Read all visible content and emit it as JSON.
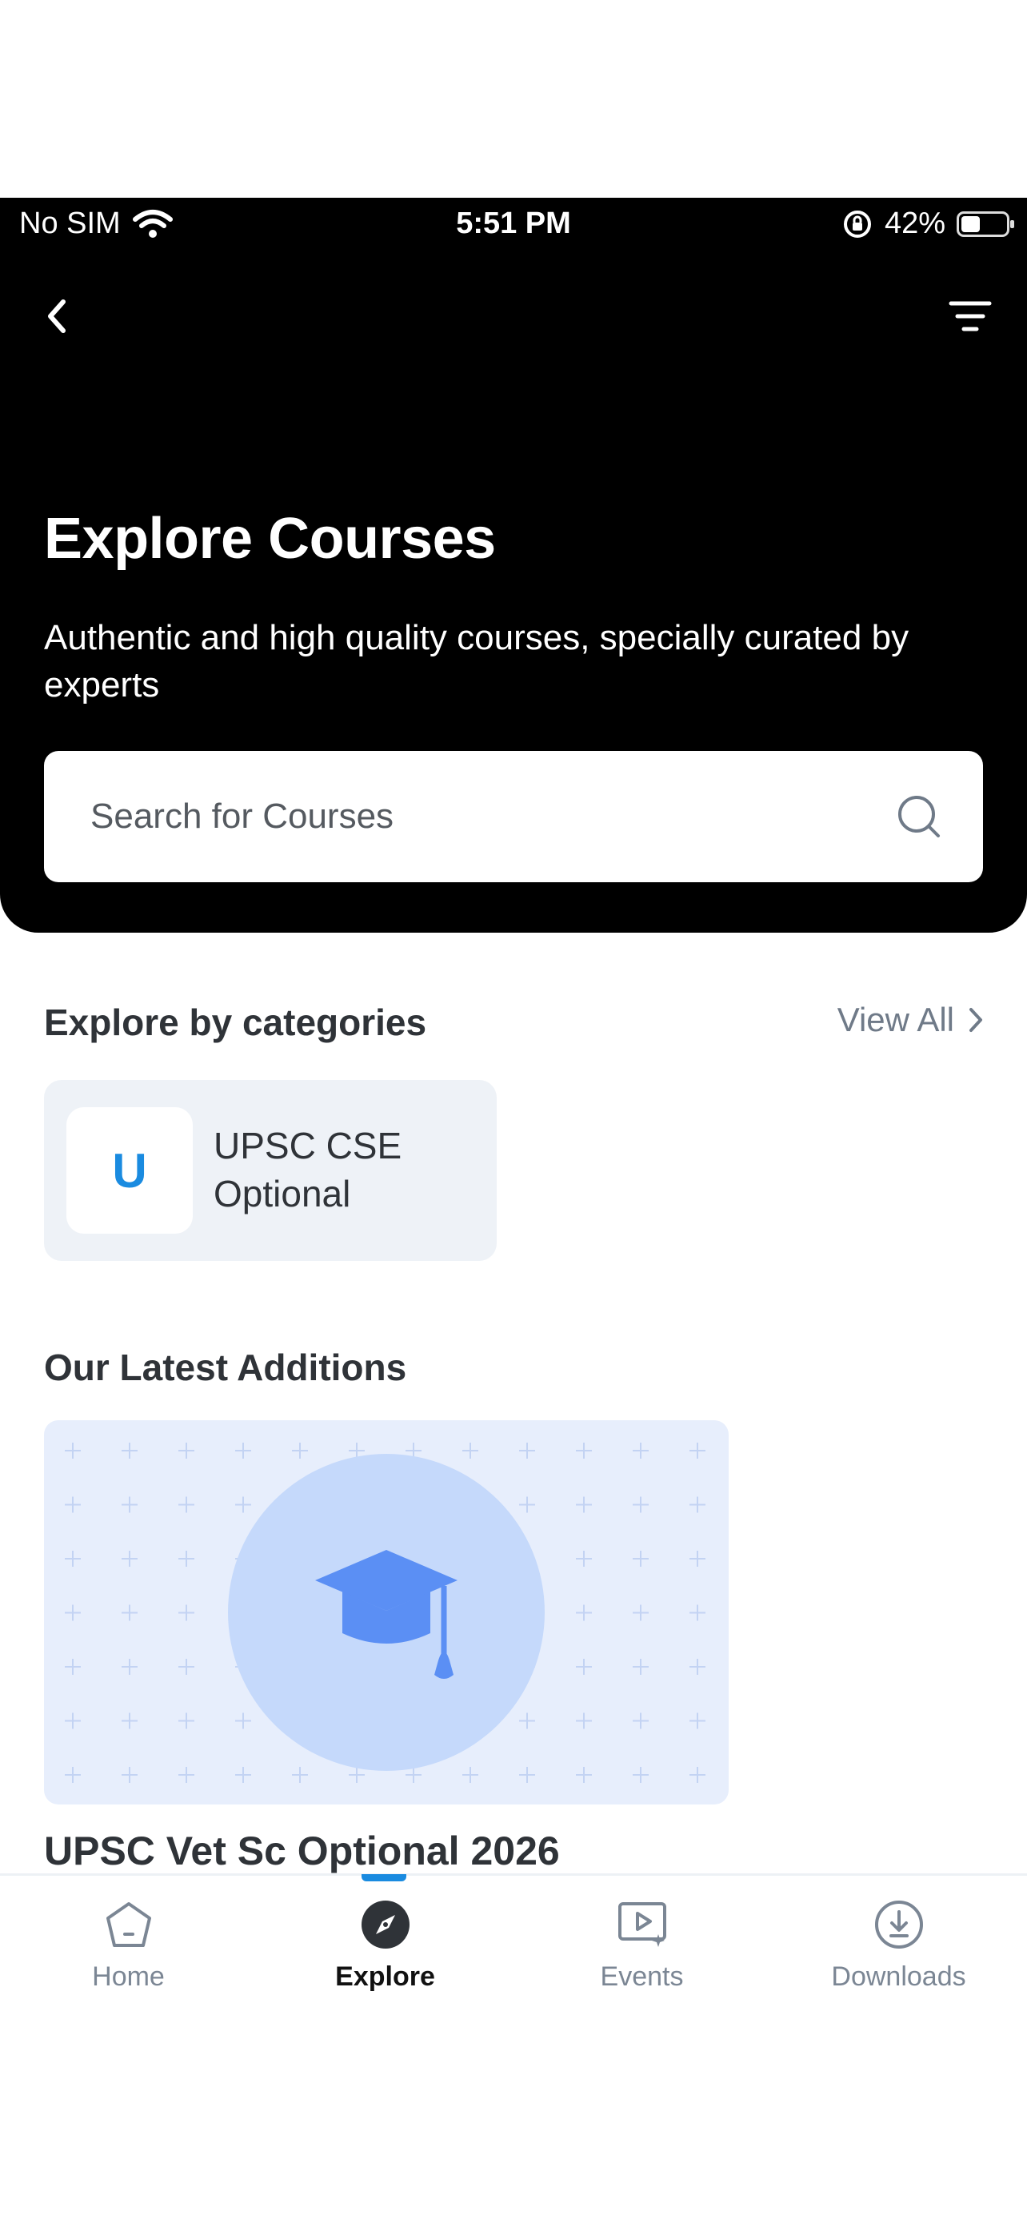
{
  "status_bar": {
    "carrier": "No SIM",
    "time": "5:51 PM",
    "battery": "42%",
    "battery_level": 0.42
  },
  "header": {
    "title": "Explore Courses",
    "subtitle": "Authentic and high quality courses, specially curated by experts",
    "back_icon": "chevron-left-icon",
    "filter_icon": "filter-icon"
  },
  "search": {
    "placeholder": "Search for Courses",
    "value": ""
  },
  "categories": {
    "title": "Explore by categories",
    "view_all": "View All",
    "items": [
      {
        "initial": "U",
        "label": "UPSC CSE Optional"
      }
    ]
  },
  "latest": {
    "title": "Our Latest Additions",
    "courses": [
      {
        "title": "UPSC Vet Sc Optional 2026",
        "image_icon": "graduation-cap-icon"
      }
    ]
  },
  "tabs": [
    {
      "label": "Home",
      "icon": "home-icon",
      "active": false
    },
    {
      "label": "Explore",
      "icon": "compass-icon",
      "active": true
    },
    {
      "label": "Events",
      "icon": "video-icon",
      "active": false
    },
    {
      "label": "Downloads",
      "icon": "download-icon",
      "active": false
    }
  ],
  "colors": {
    "accent": "#1a8be0",
    "header_bg": "#000000",
    "card_bg": "#eef2f7",
    "course_img_bg": "#e7eefc",
    "cap_color": "#5b8ff4"
  }
}
